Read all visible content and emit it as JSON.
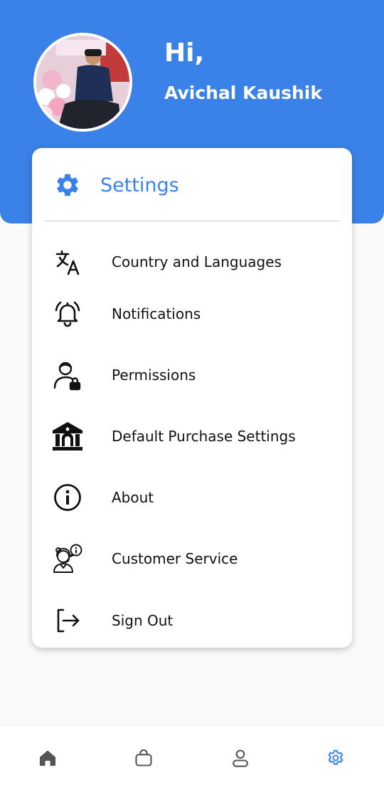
{
  "header": {
    "greeting": "Hi,",
    "username": "Avichal Kaushik",
    "background_color": "#3a82e8"
  },
  "settings_card": {
    "title": "Settings",
    "title_icon": "gear-icon",
    "accent_color": "#3a82e8",
    "items": [
      {
        "label": "Country and Languages",
        "icon": "translate-icon"
      },
      {
        "label": "Notifications",
        "icon": "bell-icon"
      },
      {
        "label": "Permissions",
        "icon": "user-lock-icon"
      },
      {
        "label": "Default Purchase Settings",
        "icon": "bank-icon"
      },
      {
        "label": "About",
        "icon": "info-icon"
      },
      {
        "label": "Customer Service",
        "icon": "support-agent-icon"
      },
      {
        "label": "Sign Out",
        "icon": "sign-out-icon"
      }
    ]
  },
  "bottom_nav": {
    "items": [
      {
        "icon": "home-icon",
        "active": false
      },
      {
        "icon": "shopping-bag-icon",
        "active": false
      },
      {
        "icon": "user-icon",
        "active": false
      },
      {
        "icon": "settings-gear-icon",
        "active": true
      }
    ],
    "active_color": "#3a82e8",
    "inactive_color": "#555555"
  }
}
